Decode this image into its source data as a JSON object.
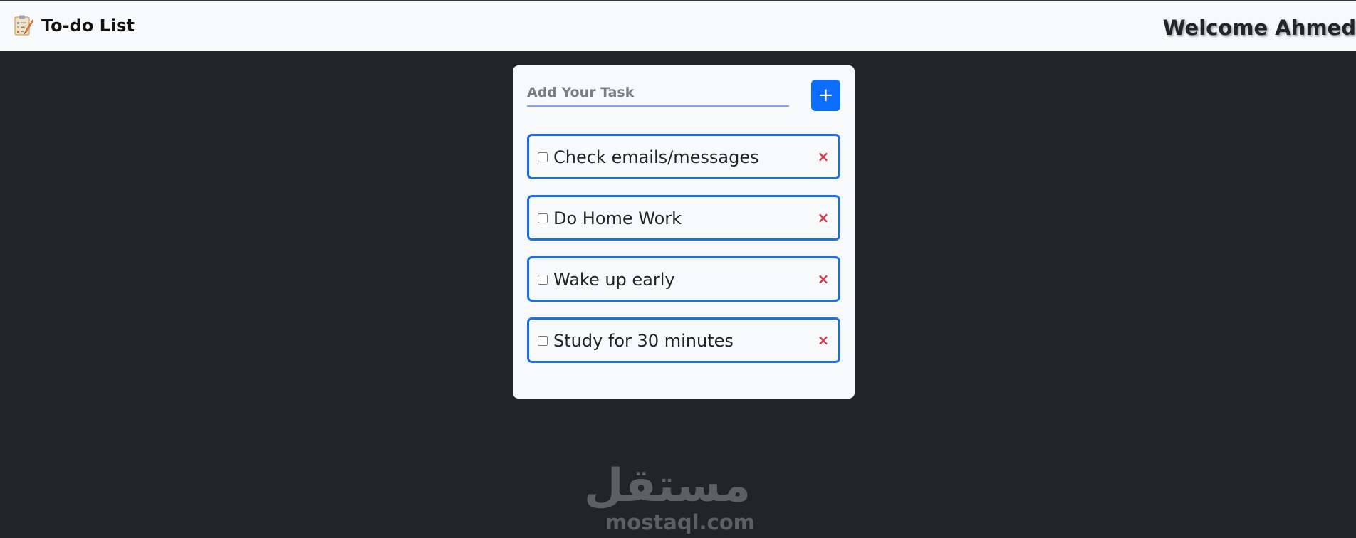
{
  "navbar": {
    "brand_icon": "notepad-icon",
    "brand": "To-do List",
    "welcome": "Welcome Ahmed"
  },
  "form": {
    "input_value": "",
    "input_placeholder": "Add Your Task",
    "add_button_label": "+",
    "add_button_icon": "plus-icon"
  },
  "tasks": [
    {
      "text": "Check emails/messages",
      "checked": false,
      "delete_label": "×"
    },
    {
      "text": "Do Home Work",
      "checked": false,
      "delete_label": "×"
    },
    {
      "text": "Wake up early",
      "checked": false,
      "delete_label": "×"
    },
    {
      "text": "Study for 30 minutes",
      "checked": false,
      "delete_label": "×"
    }
  ],
  "watermark": {
    "logo": "مستقل",
    "domain": "mostaql.com"
  },
  "colors": {
    "page_background": "#212529",
    "navbar_background": "#f8f9fa",
    "card_background": "#f8f9fa",
    "primary": "#0d6efd",
    "task_border": "#1d6fe8",
    "delete": "#dc3545",
    "watermark": "#5c6066"
  }
}
